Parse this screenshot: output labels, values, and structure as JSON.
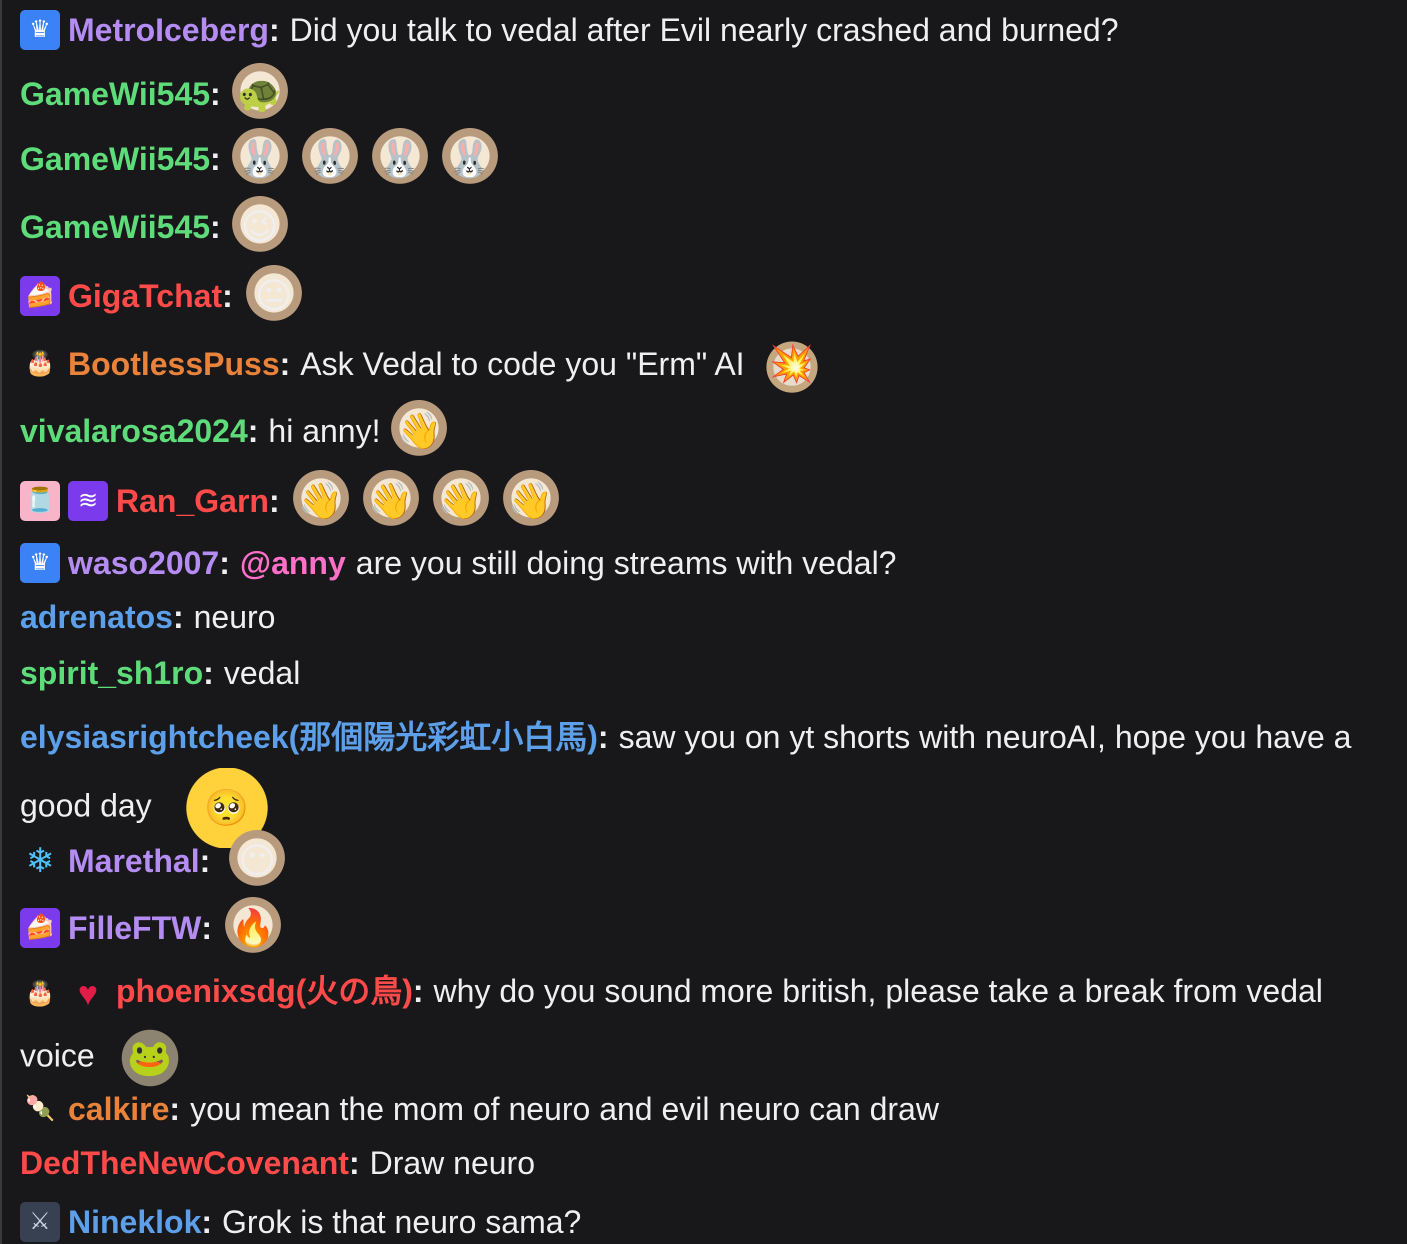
{
  "colors": {
    "background": "#18181b",
    "message_text": "#efeff1",
    "mention": "#ff6ec7"
  },
  "messages": [
    {
      "user": "MetroIceberg",
      "color": "#b48cf2",
      "badges": [
        "crown-badge"
      ],
      "text": "Did you talk to vedal after Evil nearly crashed and burned?",
      "emotes": []
    },
    {
      "user": "GameWii545",
      "color": "#5fdc7a",
      "badges": [],
      "text": "",
      "emotes": [
        "anny-turtle-emote"
      ]
    },
    {
      "user": "GameWii545",
      "color": "#5fdc7a",
      "badges": [],
      "text": "",
      "emotes": [
        "neuro-bunny-emote",
        "evil-bunny-emote",
        "neuro-bunny-emote",
        "evil-bunny-emote"
      ]
    },
    {
      "user": "GameWii545",
      "color": "#5fdc7a",
      "badges": [],
      "text": "",
      "emotes": [
        "anny-wink-emote"
      ]
    },
    {
      "user": "GigaTchat",
      "color": "#ff4a4a",
      "badges": [
        "cake-badge"
      ],
      "text": "",
      "emotes": [
        "anny-stare-emote"
      ]
    },
    {
      "user": "BootlessPuss",
      "color": "#e9823a",
      "badges": [
        "birthday-badge"
      ],
      "text": "Ask Vedal to code you \"Erm\" AI",
      "emotes": [
        "cat-explosion-emote"
      ]
    },
    {
      "user": "vivalarosa2024",
      "color": "#5fdc7a",
      "badges": [],
      "text": "hi anny!",
      "emotes": [
        "anny-wave-emote"
      ]
    },
    {
      "user": "Ran_Garn",
      "color": "#ff4a4a",
      "badges": [
        "jar-badge",
        "purple-badge"
      ],
      "text": "",
      "emotes": [
        "anny-wave-emote",
        "anny-wave-emote",
        "anny-wave-emote",
        "anny-wave-emote"
      ]
    },
    {
      "user": "waso2007",
      "color": "#b48cf2",
      "badges": [
        "crown-badge"
      ],
      "mention": "@anny",
      "text": "are you still doing streams with vedal?",
      "emotes": []
    },
    {
      "user": "adrenatos",
      "color": "#5d9fe9",
      "badges": [],
      "text": "neuro",
      "emotes": []
    },
    {
      "user": "spirit_sh1ro",
      "color": "#5fdc7a",
      "badges": [],
      "text": "vedal",
      "emotes": []
    },
    {
      "user": "elysiasrightcheek(那個陽光彩虹小白馬)",
      "color": "#5d9fe9",
      "badges": [],
      "text": "saw you on yt shorts with neuroAI, hope you have a good day",
      "emotes": [
        "pleading-emote"
      ]
    },
    {
      "user": "Marethal",
      "color": "#b48cf2",
      "badges": [
        "snowflake-badge"
      ],
      "text": "",
      "emotes": [
        "anny-side-emote"
      ]
    },
    {
      "user": "FilleFTW",
      "color": "#b48cf2",
      "badges": [
        "cake-badge"
      ],
      "text": "",
      "emotes": [
        "anny-fire-emote"
      ]
    },
    {
      "user": "phoenixsdg(火の鳥)",
      "color": "#ff4a4a",
      "badges": [
        "birthday-badge",
        "heart-badge"
      ],
      "text": "why do you sound more british, please take a break from vedal voice",
      "emotes": [
        "frog-stare-emote"
      ]
    },
    {
      "user": "calkire",
      "color": "#e9823a",
      "badges": [
        "popsicle-badge"
      ],
      "text": "you mean the mom of neuro and evil neuro can draw",
      "emotes": []
    },
    {
      "user": "DedTheNewCovenant",
      "color": "#ff4a4a",
      "badges": [],
      "text": "Draw neuro",
      "emotes": []
    },
    {
      "user": "Nineklok",
      "color": "#5d9fe9",
      "badges": [
        "ninja-badge"
      ],
      "text": "Grok is that neuro sama?",
      "emotes": []
    }
  ]
}
